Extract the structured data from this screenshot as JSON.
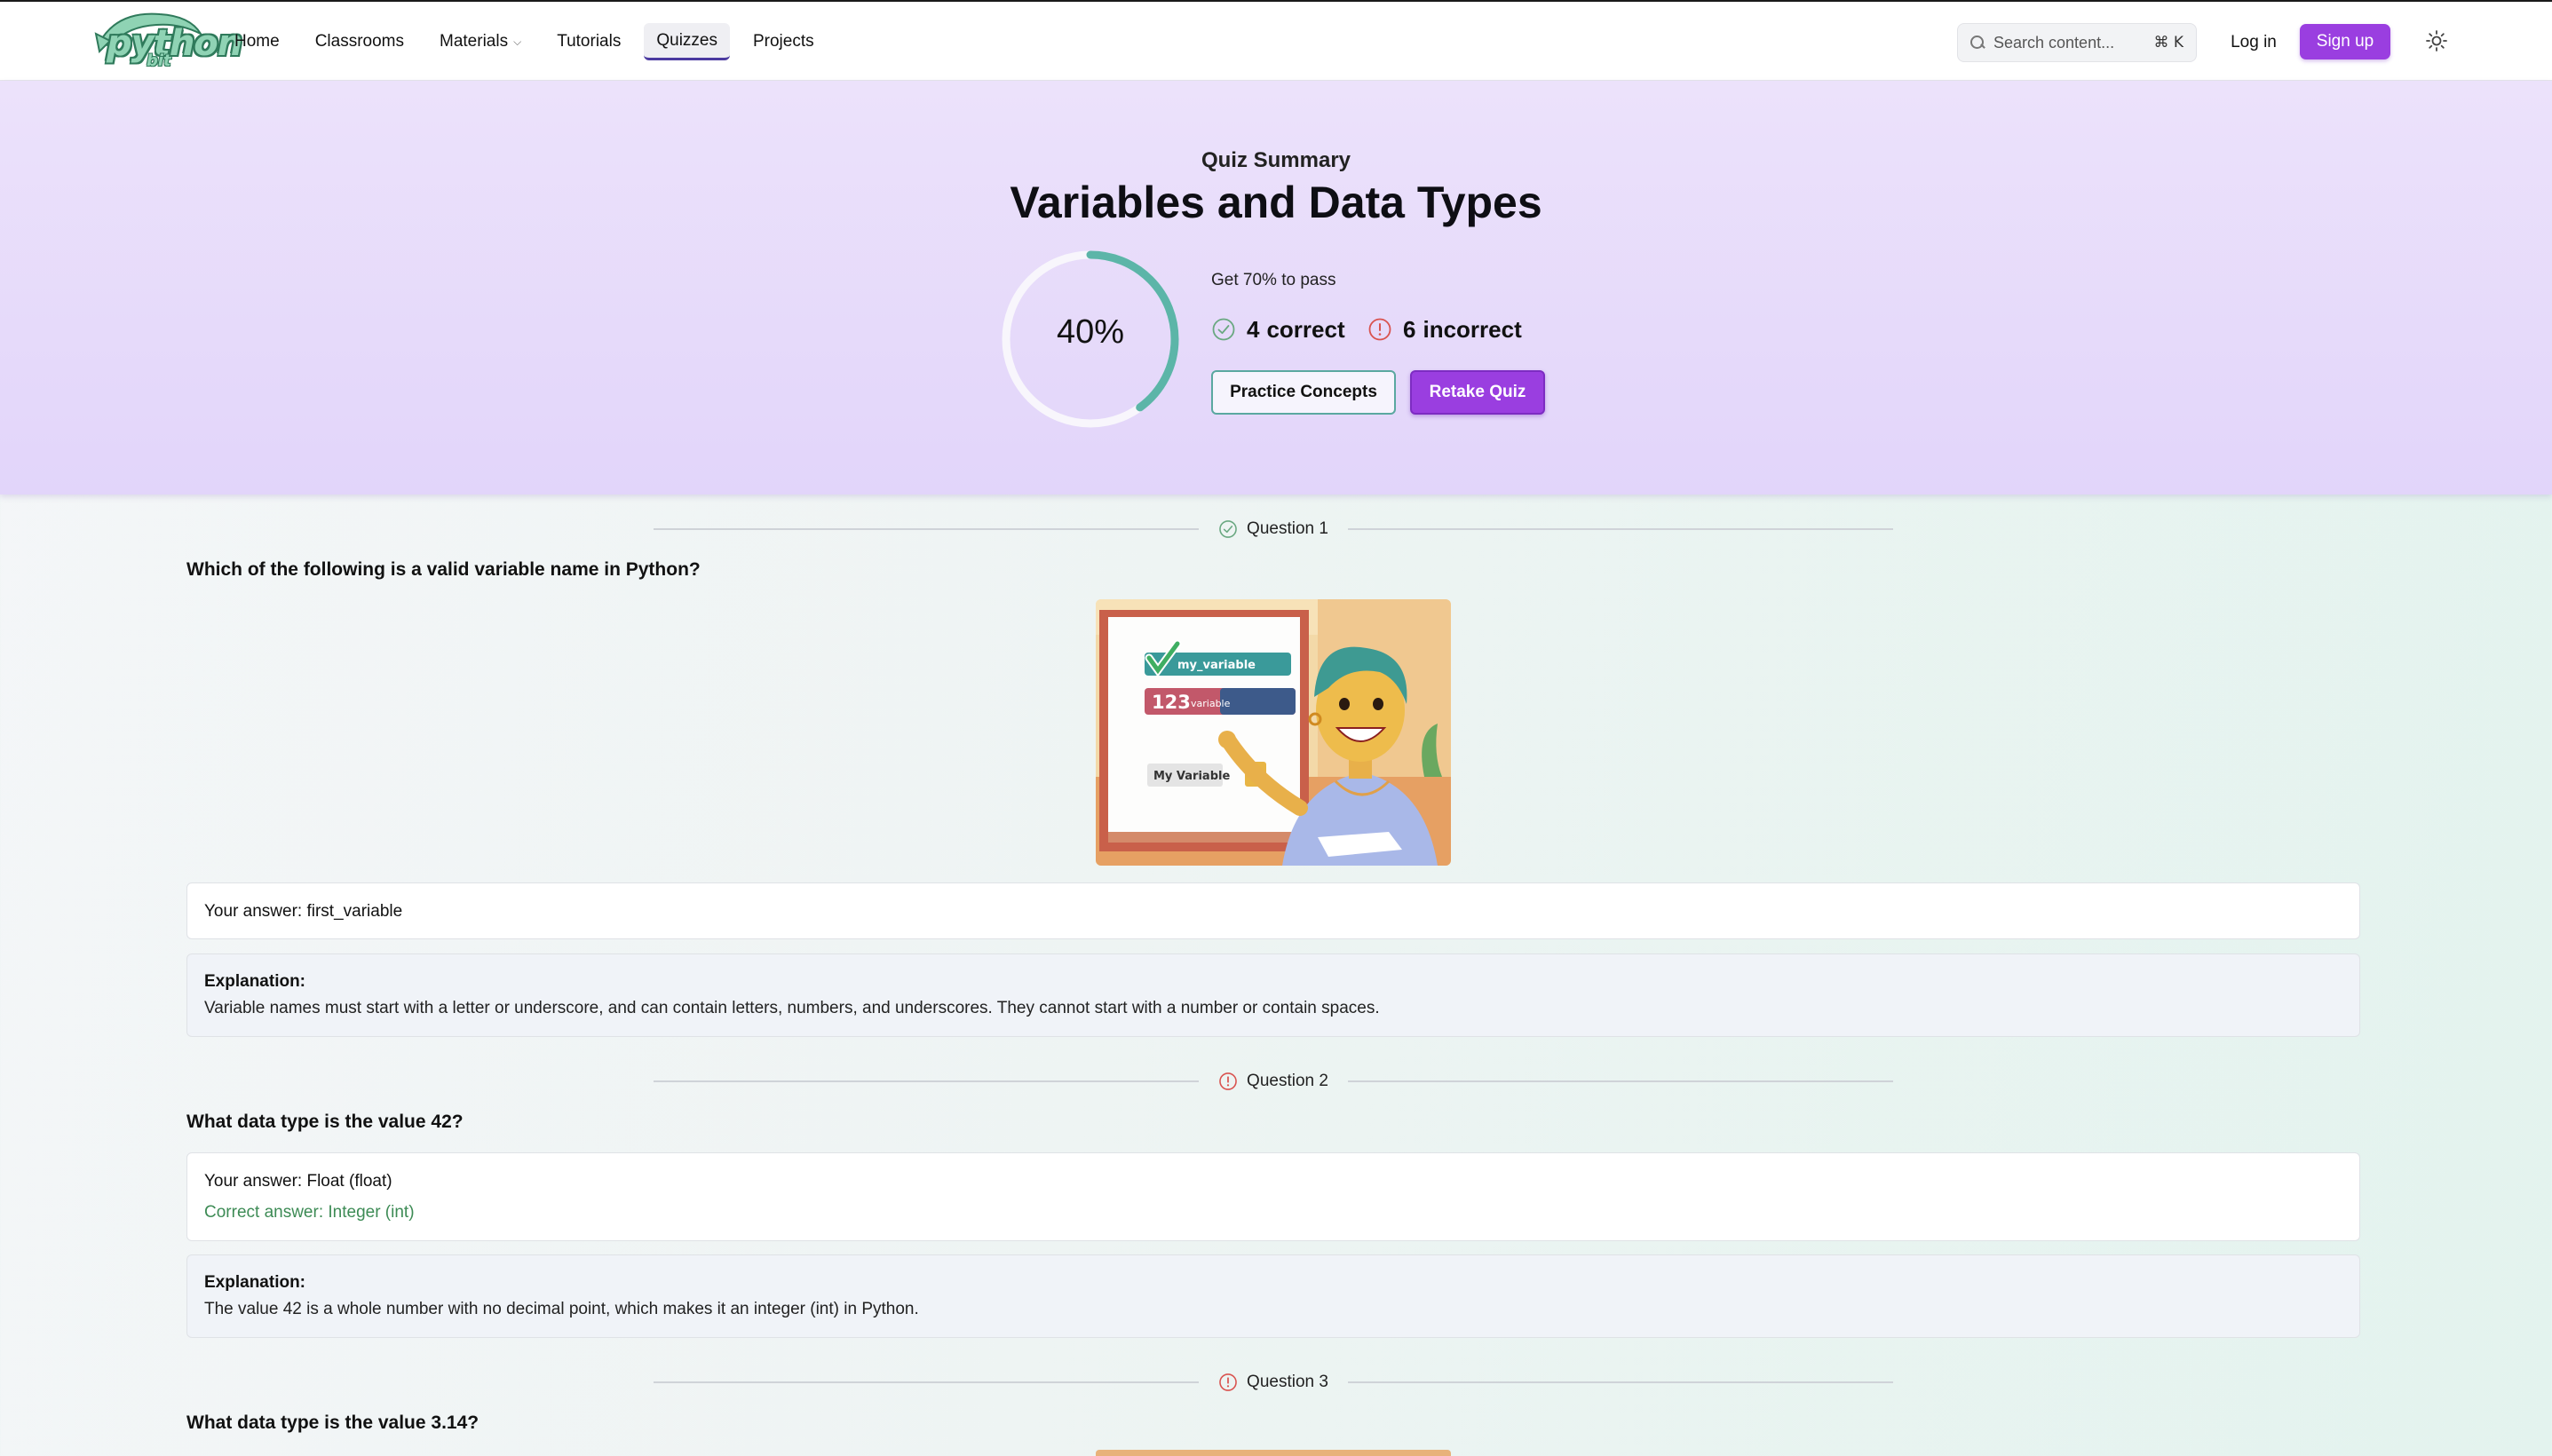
{
  "brand": {
    "logo_text": "python",
    "logo_sub": "bit"
  },
  "nav": {
    "items": [
      {
        "label": "Home"
      },
      {
        "label": "Classrooms"
      },
      {
        "label": "Materials",
        "has_dropdown": true
      },
      {
        "label": "Tutorials"
      },
      {
        "label": "Quizzes",
        "active": true
      },
      {
        "label": "Projects"
      }
    ]
  },
  "header": {
    "search_placeholder": "Search content...",
    "search_shortcut": "⌘ K",
    "login_label": "Log in",
    "signup_label": "Sign up",
    "theme_icon": "sun-icon"
  },
  "summary": {
    "kicker": "Quiz Summary",
    "title": "Variables and Data Types",
    "score_label": "40%",
    "score_fraction": 0.4,
    "pass_text": "Get 70% to pass",
    "correct_count": "4",
    "correct_word": "correct",
    "incorrect_count": "6",
    "incorrect_word": "incorrect",
    "practice_label": "Practice Concepts",
    "retake_label": "Retake Quiz"
  },
  "questions": [
    {
      "label": "Question 1",
      "status": "correct",
      "text": "Which of the following is a valid variable name in Python?",
      "image": {
        "board_row_1": "my_variable",
        "board_row_2_num": "123",
        "board_row_2_text": "variable",
        "board_row_3": "My Variable"
      },
      "your_answer": "Your answer: first_variable",
      "explanation_title": "Explanation:",
      "explanation": "Variable names must start with a letter or underscore, and can contain letters, numbers, and underscores. They cannot start with a number or contain spaces."
    },
    {
      "label": "Question 2",
      "status": "incorrect",
      "text": "What data type is the value 42?",
      "your_answer": "Your answer: Float (float)",
      "correct_answer": "Correct answer: Integer (int)",
      "explanation_title": "Explanation:",
      "explanation": "The value 42 is a whole number with no decimal point, which makes it an integer (int) in Python."
    },
    {
      "label": "Question 3",
      "status": "incorrect",
      "text": "What data type is the value 3.14?"
    }
  ],
  "colors": {
    "brand_purple": "#9a3ee0",
    "ring_teal": "#5cb5a8",
    "correct_green": "#3d8b55",
    "incorrect_red": "#d9534f"
  }
}
